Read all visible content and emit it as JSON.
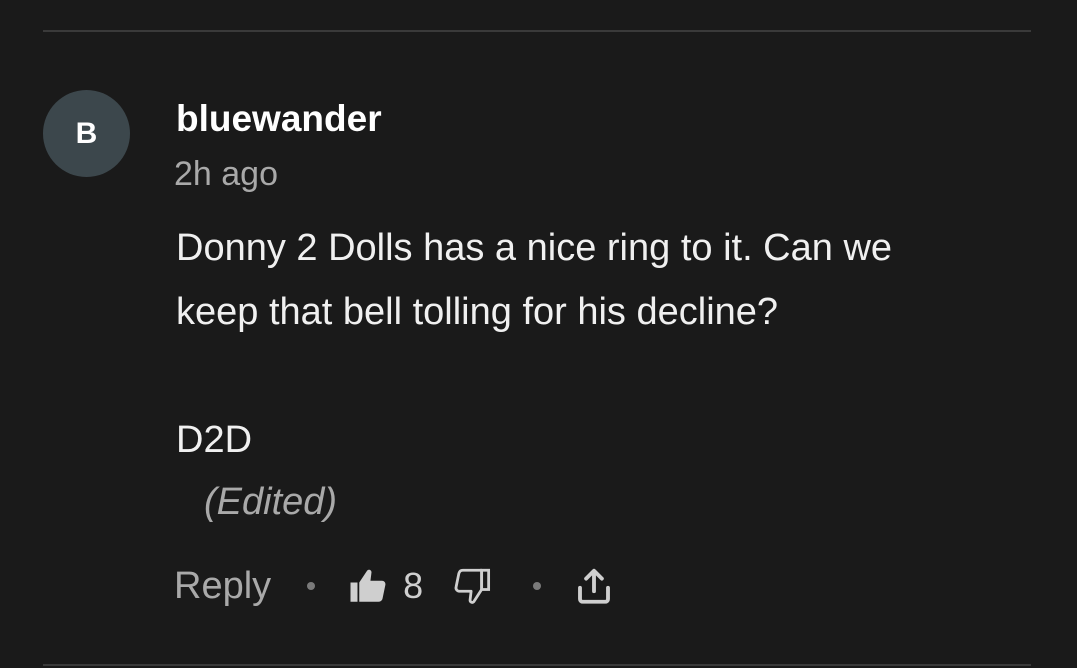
{
  "comment": {
    "avatar_initial": "B",
    "username": "bluewander",
    "timestamp": "2h ago",
    "body_lines": [
      "Donny 2 Dolls has a nice ring to it. Can we",
      "keep that bell tolling for his decline?",
      "",
      "D2D"
    ],
    "edited_label": "(Edited)"
  },
  "actions": {
    "reply_label": "Reply",
    "like_count": "8",
    "icons": {
      "like": "thumbs-up-icon",
      "dislike": "thumbs-down-icon",
      "share": "share-icon"
    }
  },
  "colors": {
    "background": "#1a1a1a",
    "avatar_bg": "#3c474c",
    "text_primary": "#ffffff",
    "text_secondary": "#a9a9a9"
  }
}
